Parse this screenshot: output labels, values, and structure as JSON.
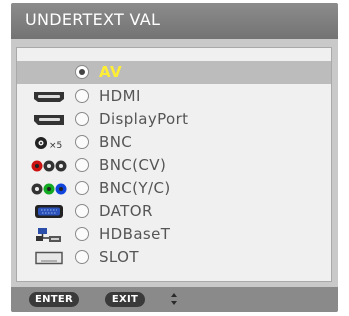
{
  "title": "UNDERTEXT VAL",
  "selected_index": 0,
  "items": [
    {
      "label": "AV",
      "icon": "av-icon"
    },
    {
      "label": "HDMI",
      "icon": "hdmi-port-icon"
    },
    {
      "label": "DisplayPort",
      "icon": "displayport-port-icon"
    },
    {
      "label": "BNC",
      "icon": "bnc-connector-icon",
      "icon_suffix": "×5"
    },
    {
      "label": "BNC(CV)",
      "icon": "bnc-cv-connectors-icon"
    },
    {
      "label": "BNC(Y/C)",
      "icon": "bnc-yc-connectors-icon"
    },
    {
      "label": "DATOR",
      "icon": "computer-port-icon"
    },
    {
      "label": "HDBaseT",
      "icon": "network-icon"
    },
    {
      "label": "SLOT",
      "icon": "slot-icon"
    }
  ],
  "footer": {
    "enter_label": "ENTER",
    "exit_label": "EXIT",
    "navigate_icon": "up-down-arrows-icon"
  },
  "colors": {
    "selected_text": "#ffee33",
    "title_bar": "#808080",
    "panel": "#c9c9c9",
    "list_background": "#f0f0f0"
  }
}
